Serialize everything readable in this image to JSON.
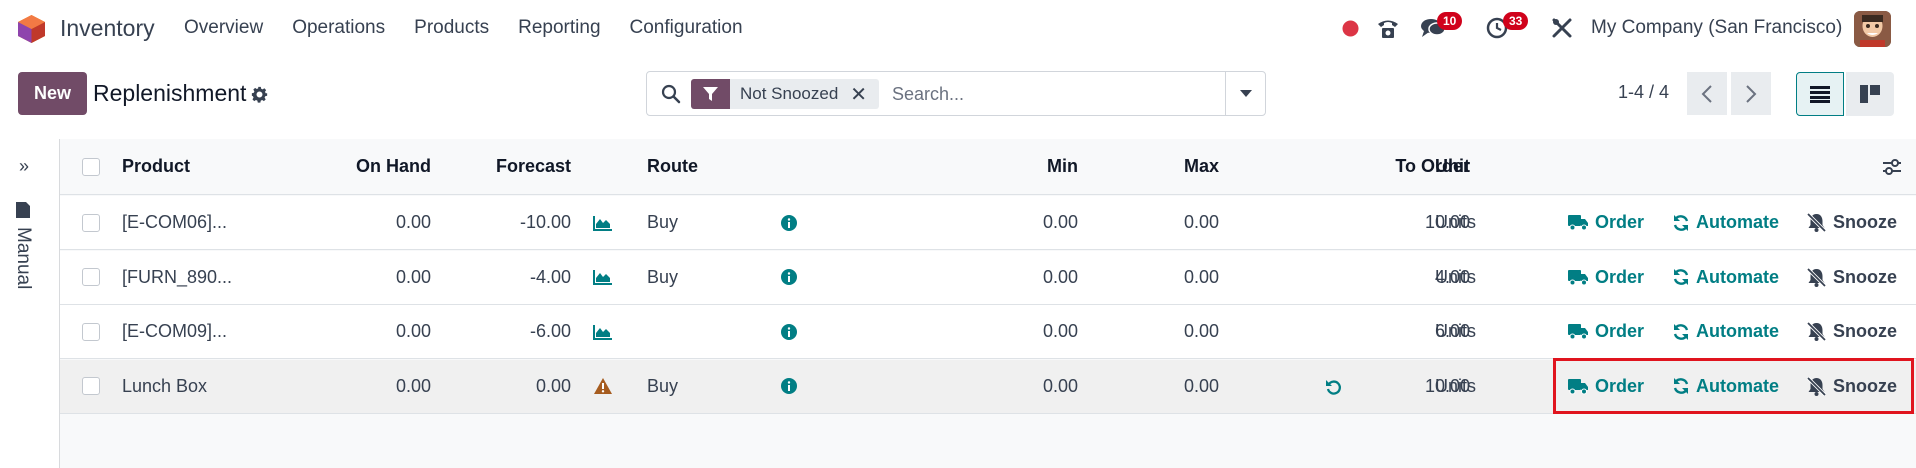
{
  "app": {
    "name": "Inventory"
  },
  "menu": [
    "Overview",
    "Operations",
    "Products",
    "Reporting",
    "Configuration"
  ],
  "systray": {
    "messages_badge": "10",
    "activities_badge": "33",
    "company": "My Company (San Francisco)"
  },
  "control": {
    "new_label": "New",
    "title": "Replenishment",
    "facet": "Not Snoozed",
    "search_placeholder": "Search...",
    "pager": "1-4 / 4"
  },
  "side": {
    "label": "Manual"
  },
  "columns": {
    "product": "Product",
    "on_hand": "On Hand",
    "forecast": "Forecast",
    "route": "Route",
    "min": "Min",
    "max": "Max",
    "to_order": "To Order",
    "unit": "Unit"
  },
  "actions": {
    "order": "Order",
    "automate": "Automate",
    "snooze": "Snooze"
  },
  "rows": [
    {
      "product": "[E-COM06]...",
      "on_hand": "0.00",
      "forecast": "-10.00",
      "forecast_icon": "area-chart-icon",
      "route": "Buy",
      "min": "0.00",
      "max": "0.00",
      "to_order": "10.00",
      "unit": "Units"
    },
    {
      "product": "[FURN_890...",
      "on_hand": "0.00",
      "forecast": "-4.00",
      "forecast_icon": "area-chart-icon",
      "route": "Buy",
      "min": "0.00",
      "max": "0.00",
      "to_order": "4.00",
      "unit": "Units"
    },
    {
      "product": "[E-COM09]...",
      "on_hand": "0.00",
      "forecast": "-6.00",
      "forecast_icon": "area-chart-icon",
      "route": "",
      "min": "0.00",
      "max": "0.00",
      "to_order": "6.00",
      "unit": "Units"
    },
    {
      "product": "Lunch Box",
      "on_hand": "0.00",
      "forecast": "0.00",
      "forecast_icon": "warning-icon",
      "route": "Buy",
      "min": "0.00",
      "max": "0.00",
      "to_order": "10.00",
      "unit": "Units",
      "reset_icon": "undo-icon"
    }
  ],
  "colors": {
    "primary": "#714b67",
    "action": "#017e84",
    "highlight_border": "#e0141e",
    "badge": "#d0021b"
  }
}
